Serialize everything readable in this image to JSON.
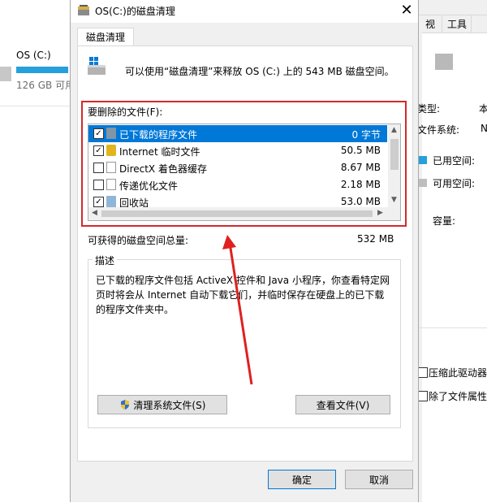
{
  "background_left": {
    "drive_name": "OS (C:)",
    "drive_size": "126 GB 可用"
  },
  "background_right": {
    "tabs": [
      "视",
      "工具",
      ""
    ],
    "labels": [
      "类型:",
      "文件系统:",
      "已用空间:",
      "可用空间:",
      "容量:",
      "压缩此驱动器以",
      "除了文件属性外"
    ],
    "values": [
      "本",
      "N"
    ]
  },
  "dialog": {
    "title": "OS(C:)的磁盘清理",
    "tab": "磁盘清理",
    "summary": "可以使用“磁盘清理”来释放 OS (C:) 上的 543 MB 磁盘空间。",
    "files_label": "要删除的文件(F):",
    "files": [
      {
        "name": "已下载的程序文件",
        "size": "0 字节",
        "checked": true
      },
      {
        "name": "Internet 临时文件",
        "size": "50.5 MB",
        "checked": true
      },
      {
        "name": "DirectX 着色器缓存",
        "size": "8.67 MB",
        "checked": false
      },
      {
        "name": "传递优化文件",
        "size": "2.18 MB",
        "checked": false
      },
      {
        "name": "回收站",
        "size": "53.0 MB",
        "checked": true
      }
    ],
    "total_label": "可获得的磁盘空间总量:",
    "total_value": "532 MB",
    "description_title": "描述",
    "description": "已下载的程序文件包括 ActiveX 控件和 Java 小程序，你查看特定网页时将会从 Internet 自动下载它们，并临时保存在硬盘上的已下载的程序文件夹中。",
    "description_lines": [
      "已下载的程序文件包括 ActiveX 控件和 Java 小程序，你查看特定网",
      "页时将会从 Internet 自动下载它们，并临时保存在硬盘上的已下载",
      "的程序文件夹中。"
    ],
    "cleanup_button": "清理系统文件(S)",
    "view_button": "查看文件(V)",
    "ok_button": "确定",
    "cancel_button": "取消"
  },
  "colors": {
    "accent": "#0078d7",
    "highlight_box": "#d32a2a",
    "arrow": "#e02020"
  }
}
